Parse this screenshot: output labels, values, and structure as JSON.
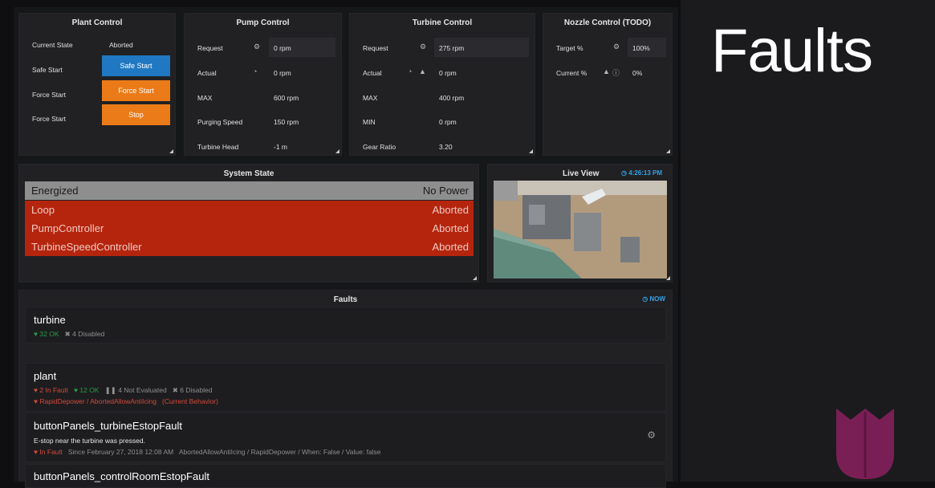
{
  "slide": {
    "title": "Faults"
  },
  "plant_control": {
    "title": "Plant Control",
    "current_state_label": "Current State",
    "current_state_value": "Aborted",
    "safe_start_label": "Safe Start",
    "safe_start_button": "Safe Start",
    "force_start_label": "Force Start",
    "force_start_button": "Force Start",
    "force_stop_label": "Force Start",
    "stop_button": "Stop"
  },
  "pump_control": {
    "title": "Pump Control",
    "request_label": "Request",
    "request_value": "0 rpm",
    "actual_label": "Actual",
    "actual_value": "0 rpm",
    "max_label": "MAX",
    "max_value": "600 rpm",
    "purging_label": "Purging Speed",
    "purging_value": "150 rpm",
    "head_label": "Turbine Head",
    "head_value": "-1 m"
  },
  "turbine_control": {
    "title": "Turbine Control",
    "request_label": "Request",
    "request_value": "275 rpm",
    "actual_label": "Actual",
    "actual_value": "0 rpm",
    "max_label": "MAX",
    "max_value": "400 rpm",
    "min_label": "MIN",
    "min_value": "0 rpm",
    "gear_label": "Gear Ratio",
    "gear_value": "3.20"
  },
  "nozzle_control": {
    "title": "Nozzle Control (TODO)",
    "target_label": "Target %",
    "target_value": "100%",
    "current_label": "Current %",
    "current_value": "0%"
  },
  "system_state": {
    "title": "System State",
    "rows": [
      {
        "name": "Energized",
        "state": "No Power",
        "color": "#8e8e8e"
      },
      {
        "name": "Loop",
        "state": "Aborted",
        "color": "#b5250e"
      },
      {
        "name": "PumpController",
        "state": "Aborted",
        "color": "#b5250e"
      },
      {
        "name": "TurbineSpeedController",
        "state": "Aborted",
        "color": "#b5250e"
      }
    ]
  },
  "live_view": {
    "title": "Live View",
    "time": "4:26:13 PM"
  },
  "faults": {
    "title": "Faults",
    "now_label": "NOW",
    "turbine": {
      "name": "turbine",
      "ok": "32 OK",
      "disabled": "4 Disabled"
    },
    "plant": {
      "name": "plant",
      "in_fault": "2 In Fault",
      "ok": "12 OK",
      "not_evaluated": "4 Not Evaluated",
      "disabled": "6 Disabled",
      "behavior": "RapidDepower / AbortedAllowAntiIcing",
      "behavior_note": "(Current Behavior)"
    },
    "estop_turbine": {
      "name": "buttonPanels_turbineEstopFault",
      "description": "E-stop near the turbine was pressed.",
      "status": "In Fault",
      "since": "Since February 27, 2018 12:08 AM",
      "detail": "AbortedAllowAntiIcing / RapidDepower / When: False / Value: false"
    },
    "estop_control": {
      "name": "buttonPanels_controlRoomEstopFault"
    }
  },
  "colors": {
    "accent_blue": "#1f78c1",
    "accent_orange": "#eb7b18",
    "fault_red": "#b5250e",
    "ok_green": "#299c46",
    "logo": "#7a1f56"
  }
}
